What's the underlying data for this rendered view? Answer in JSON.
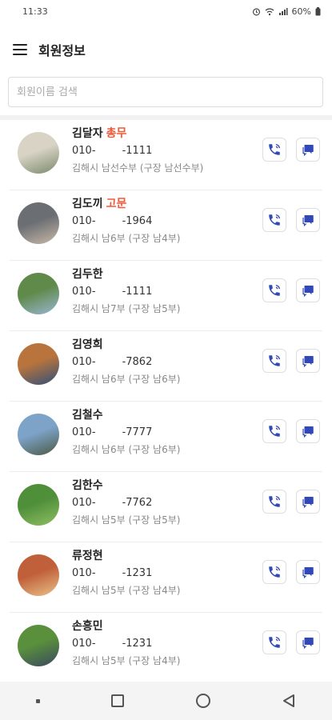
{
  "status": {
    "time": "11:33",
    "battery": "60%",
    "icons": [
      "alarm-icon",
      "wifi-icon",
      "signal-icon",
      "battery-icon"
    ]
  },
  "header": {
    "title": "회원정보",
    "menu_icon": "hamburger-menu-icon"
  },
  "search": {
    "placeholder": "회원이름 검색",
    "value": ""
  },
  "colors": {
    "role": "#f05a3a",
    "action_icon": "#3048b8"
  },
  "members": [
    {
      "name": "김달자",
      "role": "총무",
      "phone": "010-        -1111",
      "group": "김해시 남선수부 (구장 남선수부)",
      "avatar": "avatar-photo"
    },
    {
      "name": "김도끼",
      "role": "고문",
      "phone": "010-        -1964",
      "group": "김해시 남6부 (구장 남4부)",
      "avatar": "avatar-photo"
    },
    {
      "name": "김두한",
      "role": "",
      "phone": "010-        -1111",
      "group": "김해시 남7부 (구장 남5부)",
      "avatar": "avatar-photo"
    },
    {
      "name": "김영희",
      "role": "",
      "phone": "010-        -7862",
      "group": "김해시 남6부 (구장 남6부)",
      "avatar": "avatar-photo"
    },
    {
      "name": "김철수",
      "role": "",
      "phone": "010-        -7777",
      "group": "김해시 남6부 (구장 남6부)",
      "avatar": "avatar-photo"
    },
    {
      "name": "김한수",
      "role": "",
      "phone": "010-        -7762",
      "group": "김해시 남5부 (구장 남5부)",
      "avatar": "avatar-photo"
    },
    {
      "name": "류정현",
      "role": "",
      "phone": "010-        -1231",
      "group": "김해시 남5부 (구장 남4부)",
      "avatar": "avatar-photo"
    },
    {
      "name": "손흥민",
      "role": "",
      "phone": "010-        -1231",
      "group": "김해시 남5부 (구장 남4부)",
      "avatar": "avatar-photo"
    }
  ],
  "navbar": {
    "icons": [
      "recent-dot-icon",
      "overview-square-icon",
      "home-circle-icon",
      "back-triangle-icon"
    ]
  }
}
